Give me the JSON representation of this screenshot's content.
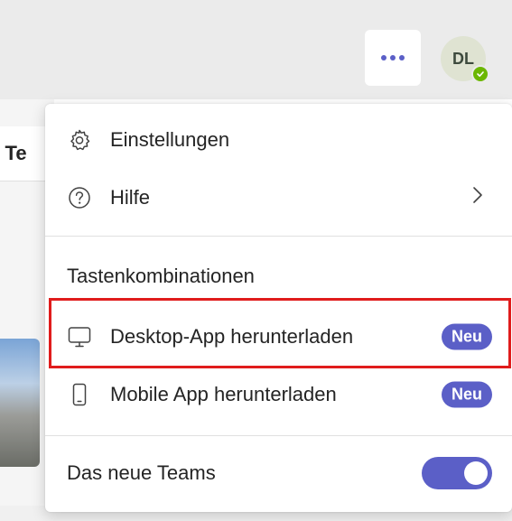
{
  "header": {
    "more_icon": "more-horizontal-icon",
    "avatar_initials": "DL",
    "presence_status": "available"
  },
  "background": {
    "partial_tab_text": "n Te"
  },
  "menu": {
    "settings_label": "Einstellungen",
    "help_label": "Hilfe",
    "shortcuts_label": "Tastenkombinationen",
    "desktop_app_label": "Desktop-App herunterladen",
    "desktop_app_badge": "Neu",
    "mobile_app_label": "Mobile App herunterladen",
    "mobile_app_badge": "Neu",
    "new_teams_label": "Das neue Teams",
    "new_teams_enabled": true
  },
  "colors": {
    "accent": "#5b5fc7",
    "highlight": "#e01c1c",
    "presence": "#6bb700"
  }
}
